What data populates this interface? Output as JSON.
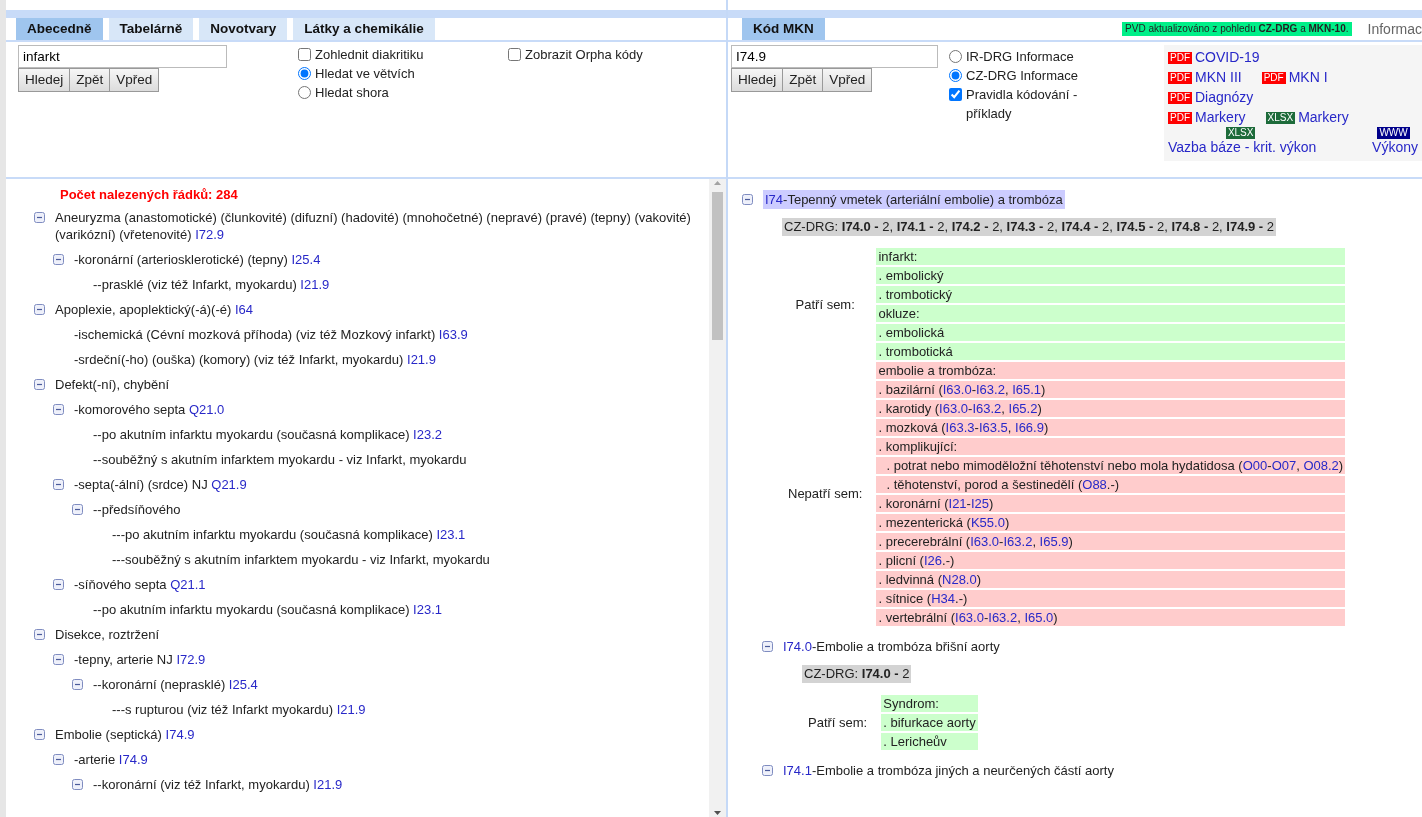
{
  "left_tabs": [
    {
      "label": "Abecedně",
      "selected": true
    },
    {
      "label": "Tabelárně",
      "selected": false
    },
    {
      "label": "Novotvary",
      "selected": false
    },
    {
      "label": "Látky a chemikálie",
      "selected": false
    }
  ],
  "left_search": {
    "value": "infarkt",
    "buttons": [
      "Hledej",
      "Zpět",
      "Vpřed"
    ],
    "options": [
      {
        "kind": "checkbox",
        "label": "Zohlednit diakritiku",
        "checked": false
      },
      {
        "kind": "radio",
        "label": "Hledat ve větvích",
        "selected": true
      },
      {
        "kind": "radio",
        "label": "Hledat shora",
        "selected": false
      }
    ],
    "extra_options": [
      {
        "kind": "checkbox",
        "label": "Zobrazit Orpha kódy",
        "checked": false
      }
    ]
  },
  "result_count": "Počet nalezených řádků: 284",
  "index_tree": [
    {
      "kind": "branch",
      "expanded": true,
      "text": "Aneuryzma (anastomotické) (člunkovité) (difuzní) (hadovité) (mnohočetné) (nepravé) (pravé) (tepny) (vakovité) (varikózní) (vřetenovité)",
      "code": "I72.9",
      "children": [
        {
          "kind": "branch",
          "expanded": true,
          "text": "-koronární (arteriosklerotické) (tepny)",
          "code": "I25.4",
          "children": [
            {
              "kind": "leaf",
              "text": "--prasklé (viz též Infarkt, myokardu)",
              "code": "I21.9"
            }
          ]
        }
      ]
    },
    {
      "kind": "branch",
      "expanded": true,
      "text": "Apoplexie, apoplektický(-á)(-é)",
      "code": "I64",
      "children": [
        {
          "kind": "leaf",
          "text": "-ischemická (Cévní mozková příhoda) (viz též Mozkový infarkt)",
          "code": "I63.9"
        },
        {
          "kind": "leaf",
          "text": "-srdeční(-ho) (ouška) (komory) (viz též Infarkt, myokardu)",
          "code": "I21.9"
        }
      ]
    },
    {
      "kind": "branch",
      "expanded": true,
      "text": "Defekt(-ní), chybění",
      "children": [
        {
          "kind": "branch",
          "expanded": true,
          "text": "-komorového septa",
          "code": "Q21.0",
          "children": [
            {
              "kind": "leaf",
              "text": "--po akutním infarktu myokardu (současná komplikace)",
              "code": "I23.2"
            },
            {
              "kind": "leaf",
              "text": "--souběžný s akutním infarktem myokardu - viz Infarkt, myokardu"
            }
          ]
        },
        {
          "kind": "branch",
          "expanded": true,
          "text": "-septa(-ální) (srdce) NJ",
          "code": "Q21.9",
          "children": [
            {
              "kind": "branch",
              "expanded": true,
              "text": "--předsíňového",
              "children": [
                {
                  "kind": "leaf",
                  "text": "---po akutním infarktu myokardu (současná komplikace)",
                  "code": "I23.1"
                },
                {
                  "kind": "leaf",
                  "text": "---souběžný s akutním infarktem myokardu - viz Infarkt, myokardu"
                }
              ]
            }
          ]
        },
        {
          "kind": "branch",
          "expanded": true,
          "text": "-síňového septa",
          "code": "Q21.1",
          "children": [
            {
              "kind": "leaf",
              "text": "--po akutním infarktu myokardu (současná komplikace)",
              "code": "I23.1"
            }
          ]
        }
      ]
    },
    {
      "kind": "branch",
      "expanded": true,
      "text": "Disekce, roztržení",
      "children": [
        {
          "kind": "branch",
          "expanded": true,
          "text": "-tepny, arterie NJ",
          "code": "I72.9",
          "children": [
            {
              "kind": "branch",
              "expanded": true,
              "text": "--koronární (neprasklé)",
              "code": "I25.4",
              "children": [
                {
                  "kind": "leaf",
                  "text": "---s rupturou (viz též Infarkt myokardu)",
                  "code": "I21.9"
                }
              ]
            }
          ]
        }
      ]
    },
    {
      "kind": "branch",
      "expanded": true,
      "text": "Embolie (septická)",
      "code": "I74.9",
      "children": [
        {
          "kind": "branch",
          "expanded": true,
          "text": "-arterie",
          "code": "I74.9",
          "children": [
            {
              "kind": "branch",
              "expanded": true,
              "text": "--koronární (viz též Infarkt, myokardu)",
              "code": "I21.9"
            }
          ]
        }
      ]
    }
  ],
  "right_tabs": [
    {
      "label": "Kód MKN",
      "selected": true
    }
  ],
  "notice": "PVD aktualizováno z pohledu **CZ-DRG** a **MKN-10**.",
  "info_tab": "Informac",
  "code_search": {
    "value": "I74.9",
    "buttons": [
      "Hledej",
      "Zpět",
      "Vpřed"
    ],
    "options": [
      {
        "kind": "radio",
        "label": "IR-DRG Informace",
        "selected": false
      },
      {
        "kind": "radio",
        "label": "CZ-DRG Informace",
        "selected": true
      },
      {
        "kind": "checkbox",
        "label": "Pravidla kódování - příklady",
        "checked": true
      }
    ]
  },
  "documents": [
    [
      {
        "kind": "inline",
        "color": "#ff0000",
        "badge": "PDF",
        "label": "COVID-19"
      }
    ],
    [
      {
        "kind": "inline",
        "color": "#ff0000",
        "badge": "PDF",
        "label": "MKN III"
      },
      {
        "kind": "inline",
        "color": "#ff0000",
        "badge": "PDF",
        "label": "MKN I"
      }
    ],
    [
      {
        "kind": "inline",
        "color": "#ff0000",
        "badge": "PDF",
        "label": "Diagnózy"
      }
    ],
    [
      {
        "kind": "inline",
        "color": "#ff0000",
        "badge": "PDF",
        "label": "Markery"
      },
      {
        "kind": "inline",
        "color": "#1d6b3a",
        "badge": "XLSX",
        "label": "Markery"
      }
    ],
    [
      {
        "kind": "stacked",
        "color": "#1d6b3a",
        "badge": "XLSX",
        "label": "Vazba báze - krit. výkon"
      },
      {
        "kind": "stacked",
        "color": "#00008b",
        "badge": "WWW",
        "label": "Výkony"
      }
    ]
  ],
  "code_tree": [
    {
      "code": "I74",
      "title": "-Tepenný vmetek (arteriální embolie) a trombóza",
      "selected": true,
      "expanded": true,
      "drg": "CZ-DRG: **I74.0 -** 2, **I74.1 -** 2, **I74.2 -** 2, **I74.3 -** 2, **I74.4 -** 2, **I74.5 -** 2, **I74.8 -** 2, **I74.9 -** 2",
      "groups": [
        {
          "kind": "include",
          "label": "Patří sem:",
          "rows": [
            {
              "indent": false,
              "parts": [
                "infarkt:"
              ]
            },
            {
              "indent": false,
              "parts": [
                ". embolický"
              ]
            },
            {
              "indent": false,
              "parts": [
                ". trombotický"
              ]
            },
            {
              "indent": false,
              "parts": [
                "okluze:"
              ]
            },
            {
              "indent": false,
              "parts": [
                ". embolická"
              ]
            },
            {
              "indent": false,
              "parts": [
                ". trombotická"
              ]
            }
          ]
        },
        {
          "kind": "exclude",
          "label": "Nepatří sem:",
          "rows": [
            {
              "indent": false,
              "parts": [
                "embolie a trombóza:"
              ]
            },
            {
              "indent": false,
              "parts": [
                ". bazilární (",
                {
                  "link": "I63.0"
                },
                "-",
                {
                  "link": "I63.2"
                },
                ", ",
                {
                  "link": "I65.1"
                },
                ")"
              ]
            },
            {
              "indent": false,
              "parts": [
                ". karotidy (",
                {
                  "link": "I63.0"
                },
                "-",
                {
                  "link": "I63.2"
                },
                ", ",
                {
                  "link": "I65.2"
                },
                ")"
              ]
            },
            {
              "indent": false,
              "parts": [
                ". mozková (",
                {
                  "link": "I63.3"
                },
                "-",
                {
                  "link": "I63.5"
                },
                ", ",
                {
                  "link": "I66.9"
                },
                ")"
              ]
            },
            {
              "indent": false,
              "parts": [
                ". komplikující:"
              ]
            },
            {
              "indent": true,
              "parts": [
                ". potrat nebo mimoděložní těhotenství nebo mola hydatidosa (",
                {
                  "link": "O00"
                },
                "-",
                {
                  "link": "O07"
                },
                ", ",
                {
                  "link": "O08.2"
                },
                ")"
              ]
            },
            {
              "indent": true,
              "parts": [
                ". těhotenství, porod a šestinedělí (",
                {
                  "link": "O88"
                },
                ".-)"
              ]
            },
            {
              "indent": false,
              "parts": [
                ". koronární (",
                {
                  "link": "I21"
                },
                "-",
                {
                  "link": "I25"
                },
                ")"
              ]
            },
            {
              "indent": false,
              "parts": [
                ". mezenterická (",
                {
                  "link": "K55.0"
                },
                ")"
              ]
            },
            {
              "indent": false,
              "parts": [
                ". precerebrální (",
                {
                  "link": "I63.0"
                },
                "-",
                {
                  "link": "I63.2"
                },
                ", ",
                {
                  "link": "I65.9"
                },
                ")"
              ]
            },
            {
              "indent": false,
              "parts": [
                ". plicní (",
                {
                  "link": "I26"
                },
                ".-)"
              ]
            },
            {
              "indent": false,
              "parts": [
                ". ledvinná (",
                {
                  "link": "N28.0"
                },
                ")"
              ]
            },
            {
              "indent": false,
              "parts": [
                ". sítnice (",
                {
                  "link": "H34"
                },
                ".-)"
              ]
            },
            {
              "indent": false,
              "parts": [
                ". vertebrální (",
                {
                  "link": "I63.0"
                },
                "-",
                {
                  "link": "I63.2"
                },
                ", ",
                {
                  "link": "I65.0"
                },
                ")"
              ]
            }
          ]
        }
      ],
      "children": [
        {
          "code": "I74.0",
          "title": "-Embolie a trombóza břišní aorty",
          "selected": false,
          "expanded": true,
          "drg": "CZ-DRG: **I74.0 -** 2",
          "groups": [
            {
              "kind": "include",
              "label": "Patří sem:",
              "rows": [
                {
                  "indent": false,
                  "parts": [
                    "Syndrom:"
                  ]
                },
                {
                  "indent": false,
                  "parts": [
                    ". bifurkace aorty"
                  ]
                },
                {
                  "indent": false,
                  "parts": [
                    ". Lericheův"
                  ]
                }
              ]
            }
          ]
        },
        {
          "code": "I74.1",
          "title": "-Embolie a trombóza jiných a neurčených částí aorty",
          "selected": false,
          "expanded": true
        }
      ]
    }
  ]
}
